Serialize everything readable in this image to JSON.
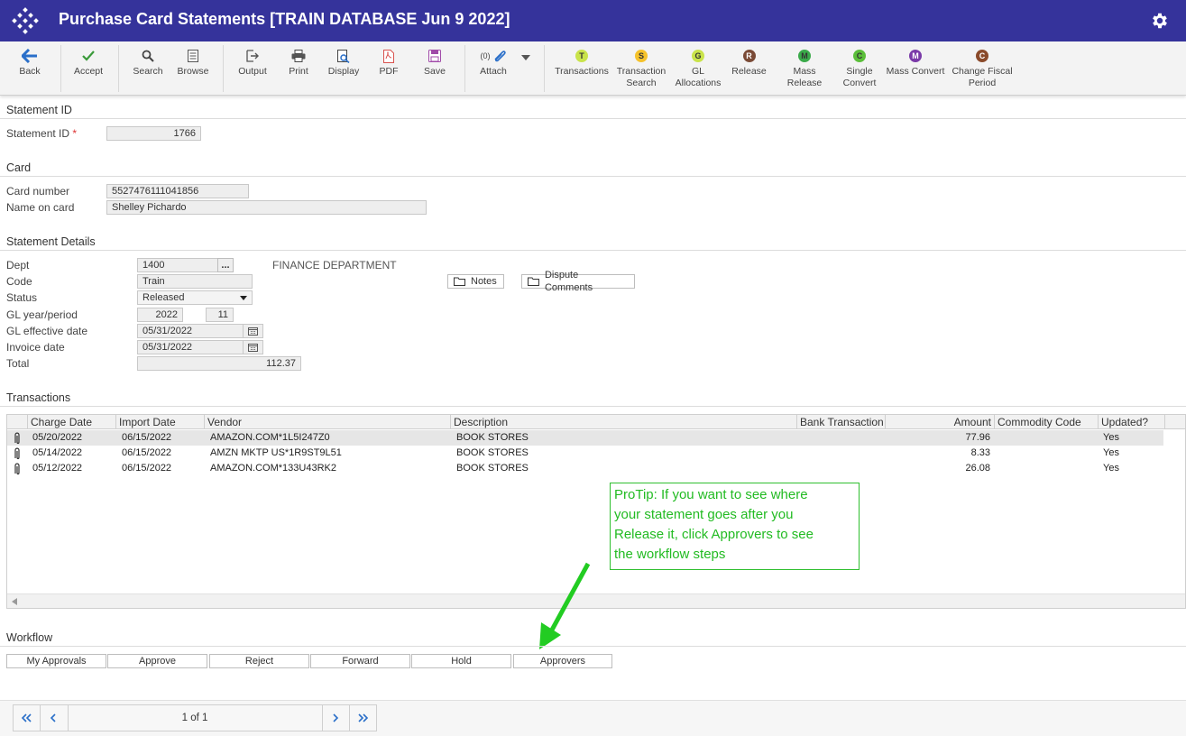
{
  "window": {
    "title": "Purchase Card Statements [TRAIN DATABASE Jun 9 2022]"
  },
  "toolbar": {
    "back": "Back",
    "accept": "Accept",
    "search": "Search",
    "browse": "Browse",
    "output": "Output",
    "print": "Print",
    "display": "Display",
    "pdf": "PDF",
    "save": "Save",
    "attach": "Attach",
    "attach_count": "(0)",
    "transactions": "Transactions",
    "transactions_letter": "T",
    "transaction_search_1": "Transaction",
    "transaction_search_2": "Search",
    "transaction_search_letter": "S",
    "gl_allocations_1": "GL",
    "gl_allocations_2": "Allocations",
    "gl_allocations_letter": "G",
    "release": "Release",
    "release_letter": "R",
    "mass_release": "Mass Release",
    "mass_release_letter": "M",
    "single_convert_1": "Single",
    "single_convert_2": "Convert",
    "single_convert_letter": "C",
    "mass_convert": "Mass Convert",
    "mass_convert_letter": "M",
    "change_fiscal_1": "Change Fiscal",
    "change_fiscal_2": "Period",
    "change_fiscal_letter": "C"
  },
  "statement_id_section": {
    "heading": "Statement ID",
    "label": "Statement ID",
    "required_mark": "*",
    "value": "1766"
  },
  "card_section": {
    "heading": "Card",
    "card_number_label": "Card number",
    "card_number": "5527476111041856",
    "name_label": "Name on card",
    "name": "Shelley Pichardo"
  },
  "details": {
    "heading": "Statement Details",
    "dept_label": "Dept",
    "dept_value": "1400",
    "dept_lookup": "...",
    "dept_name": "FINANCE DEPARTMENT",
    "code_label": "Code",
    "code_value": "Train",
    "status_label": "Status",
    "status_value": "Released",
    "gl_label": "GL year/period",
    "gl_year": "2022",
    "gl_period": "11",
    "gl_eff_label": "GL effective date",
    "gl_eff_value": "05/31/2022",
    "invoice_label": "Invoice date",
    "invoice_value": "05/31/2022",
    "total_label": "Total",
    "total_value": "112.37",
    "notes_btn": "Notes",
    "dispute_btn": "Dispute Comments"
  },
  "transactions": {
    "heading": "Transactions",
    "columns": {
      "charge_date": "Charge Date",
      "import_date": "Import Date",
      "vendor": "Vendor",
      "description": "Description",
      "bank_transaction": "Bank Transaction",
      "amount": "Amount",
      "commodity_code": "Commodity Code",
      "updated": "Updated?"
    },
    "rows": [
      {
        "charge_date": "05/20/2022",
        "import_date": "06/15/2022",
        "vendor": "AMAZON.COM*1L5I247Z0",
        "description": "BOOK STORES",
        "bank_transaction": "",
        "amount": "77.96",
        "commodity_code": "",
        "updated": "Yes"
      },
      {
        "charge_date": "05/14/2022",
        "import_date": "06/15/2022",
        "vendor": "AMZN MKTP US*1R9ST9L51",
        "description": "BOOK STORES",
        "bank_transaction": "",
        "amount": "8.33",
        "commodity_code": "",
        "updated": "Yes"
      },
      {
        "charge_date": "05/12/2022",
        "import_date": "06/15/2022",
        "vendor": "AMAZON.COM*133U43RK2",
        "description": "BOOK STORES",
        "bank_transaction": "",
        "amount": "26.08",
        "commodity_code": "",
        "updated": "Yes"
      }
    ]
  },
  "protip": {
    "line1": "ProTip: If you want to see where",
    "line2": "your statement goes after you",
    "line3": "Release it, click Approvers to see",
    "line4": "the workflow steps"
  },
  "workflow": {
    "heading": "Workflow",
    "my_approvals": "My Approvals",
    "approve": "Approve",
    "reject": "Reject",
    "forward": "Forward",
    "hold": "Hold",
    "approvers": "Approvers"
  },
  "pager": {
    "text": "1 of 1"
  },
  "colors": {
    "title_bar": "#35339b",
    "protip_green": "#22bb22"
  }
}
